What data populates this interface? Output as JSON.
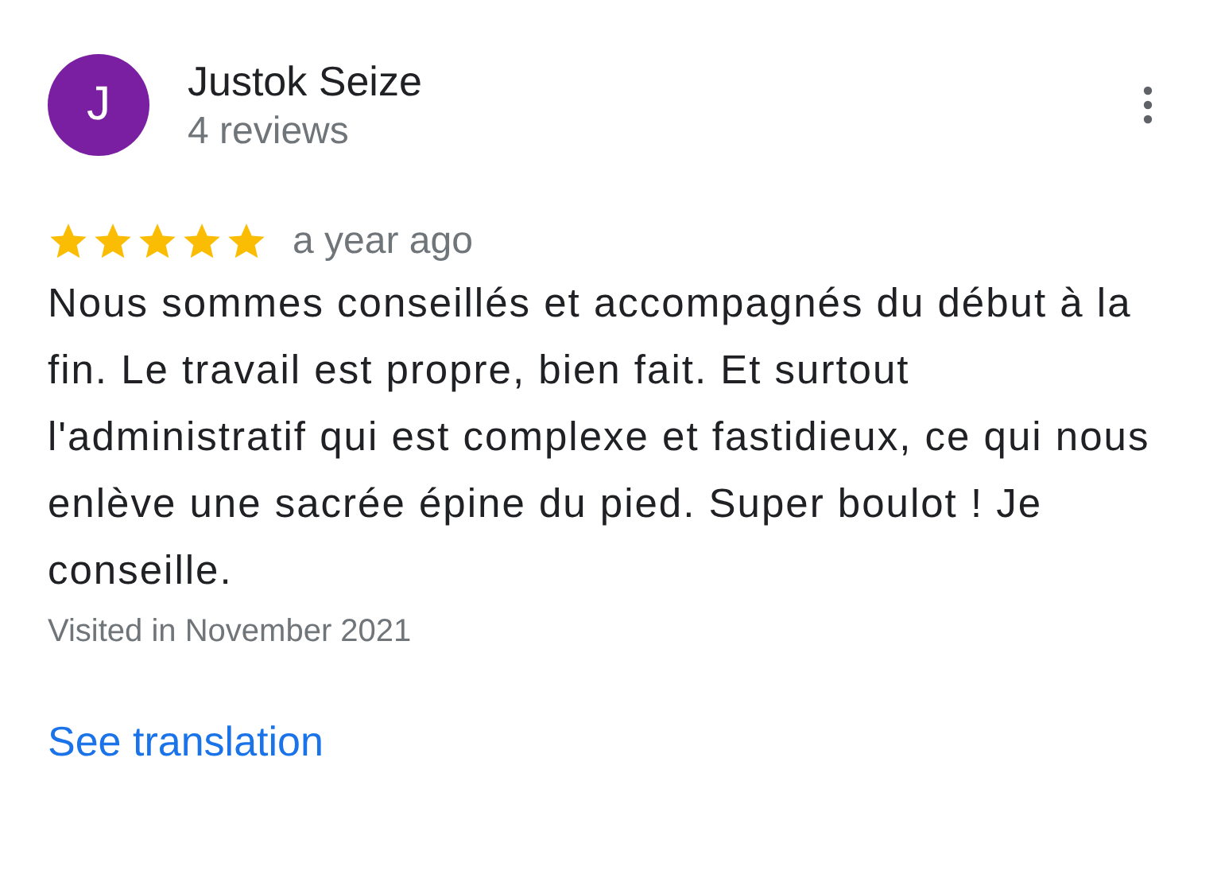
{
  "reviewer": {
    "initial": "J",
    "name": "Justok Seize",
    "review_count": "4 reviews"
  },
  "review": {
    "stars": 5,
    "time": "a year ago",
    "text": "Nous sommes conseillés et accompagnés du début à la fin. Le travail est propre, bien fait. Et surtout l'administratif qui est complexe et fastidieux, ce qui nous enlève une sacrée épine du pied. Super boulot ! Je conseille.",
    "visited": "Visited in November 2021"
  },
  "link": "See translation"
}
